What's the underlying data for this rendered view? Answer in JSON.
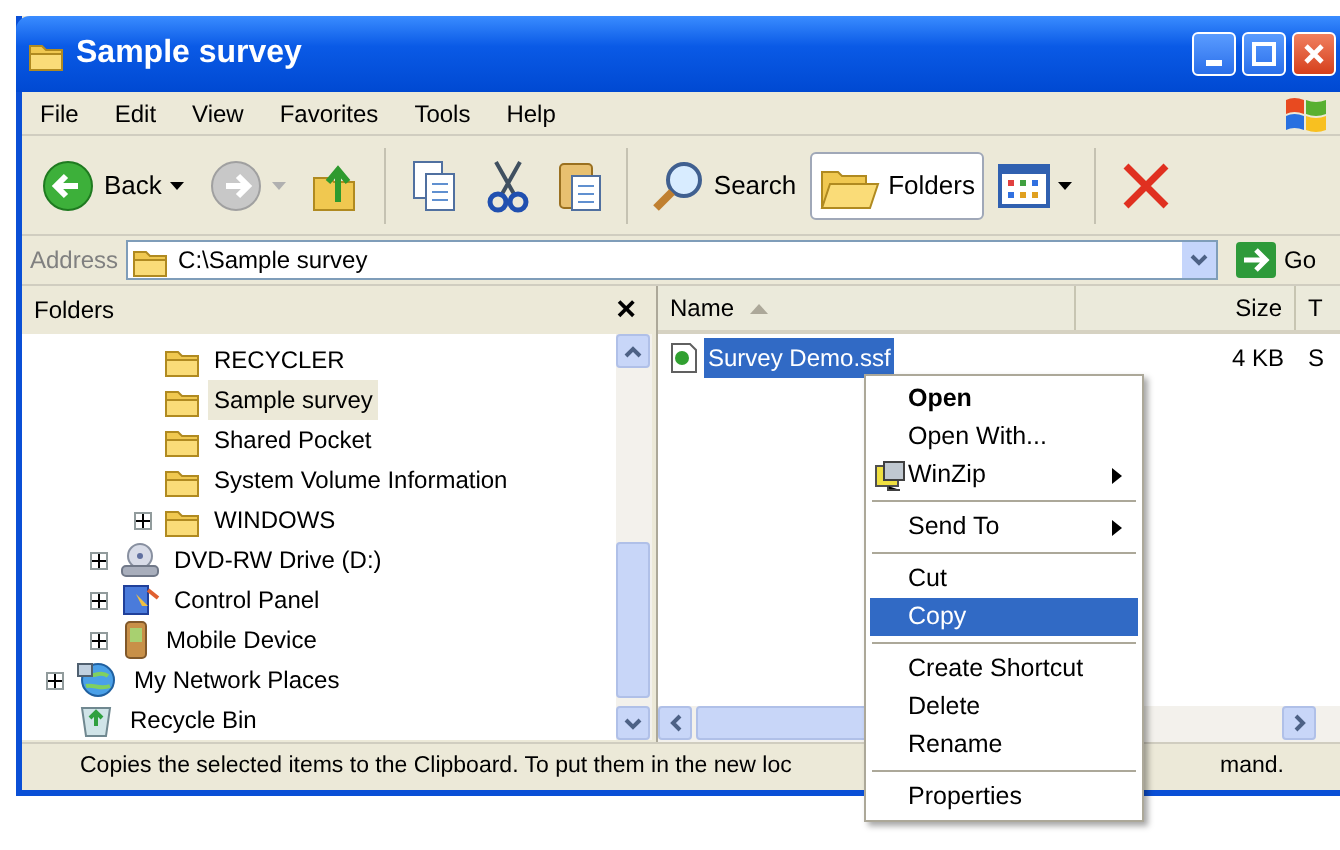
{
  "window": {
    "title": "Sample survey"
  },
  "menu_bar": [
    "File",
    "Edit",
    "View",
    "Favorites",
    "Tools",
    "Help"
  ],
  "toolbar": [
    {
      "kind": "back",
      "label": "Back",
      "disabled": false
    },
    {
      "kind": "forward",
      "disabled": true
    },
    {
      "kind": "up"
    },
    {
      "kind": "separator"
    },
    {
      "kind": "copy-to"
    },
    {
      "kind": "cut"
    },
    {
      "kind": "paste"
    },
    {
      "kind": "separator"
    },
    {
      "kind": "search",
      "label": "Search",
      "pressed": false
    },
    {
      "kind": "folders",
      "label": "Folders",
      "pressed": true
    },
    {
      "kind": "views"
    },
    {
      "kind": "separator"
    },
    {
      "kind": "delete"
    }
  ],
  "address_bar": {
    "label": "Address",
    "value": "C:\\Sample survey",
    "go": "Go"
  },
  "folders_pane": {
    "title": "Folders",
    "close": "×",
    "tree": [
      {
        "children": [
          {
            "children": [
              {
                "label": "RECYCLER",
                "kind": "folder",
                "expandable": false,
                "selected": false
              },
              {
                "label": "Sample survey",
                "kind": "folder",
                "expandable": false,
                "selected": true
              },
              {
                "label": "Shared Pocket",
                "kind": "folder",
                "expandable": false,
                "selected": false
              },
              {
                "label": "System Volume Information",
                "kind": "folder",
                "expandable": false,
                "selected": false
              },
              {
                "label": "WINDOWS",
                "kind": "folder",
                "expandable": true,
                "selected": false
              }
            ]
          },
          {
            "label": "DVD-RW Drive (D:)",
            "kind": "dvd",
            "expandable": true,
            "selected": false
          },
          {
            "label": "Control Panel",
            "kind": "control",
            "expandable": true,
            "selected": false
          },
          {
            "label": "Mobile Device",
            "kind": "mobile",
            "expandable": true,
            "selected": false
          }
        ]
      },
      {
        "label": "My Network Places",
        "kind": "network",
        "expandable": true,
        "selected": false
      },
      {
        "label": "Recycle Bin",
        "kind": "recycle",
        "expandable": false,
        "selected": false
      }
    ]
  },
  "file_list": {
    "columns": [
      {
        "label": "Name",
        "sorted": true
      },
      {
        "label": "Size",
        "sorted": false
      },
      {
        "label": "T",
        "sorted": false
      }
    ],
    "rows": [
      {
        "cells": [
          "Survey Demo.ssf",
          "4 KB",
          "S"
        ],
        "selected": true
      }
    ]
  },
  "context_menu": [
    {
      "kind": "item",
      "label": "Open",
      "default": true,
      "submenu": false,
      "selected": false
    },
    {
      "kind": "item",
      "label": "Open With...",
      "default": false,
      "submenu": false,
      "selected": false
    },
    {
      "kind": "icon-item",
      "label": "WinZip",
      "default": false,
      "submenu": true,
      "selected": false
    },
    {
      "kind": "separator"
    },
    {
      "kind": "item",
      "label": "Send To",
      "default": false,
      "submenu": true,
      "selected": false
    },
    {
      "kind": "separator"
    },
    {
      "kind": "item",
      "label": "Cut",
      "default": false,
      "submenu": false,
      "selected": false
    },
    {
      "kind": "item",
      "label": "Copy",
      "default": false,
      "submenu": false,
      "selected": true
    },
    {
      "kind": "separator"
    },
    {
      "kind": "item",
      "label": "Create Shortcut",
      "default": false,
      "submenu": false,
      "selected": false
    },
    {
      "kind": "item",
      "label": "Delete",
      "default": false,
      "submenu": false,
      "selected": false
    },
    {
      "kind": "item",
      "label": "Rename",
      "default": false,
      "submenu": false,
      "selected": false
    },
    {
      "kind": "separator"
    },
    {
      "kind": "item",
      "label": "Properties",
      "default": false,
      "submenu": false,
      "selected": false
    }
  ],
  "status_bar": [
    "Copies the selected items to the Clipboard. To put them in the new loc",
    "mand."
  ]
}
